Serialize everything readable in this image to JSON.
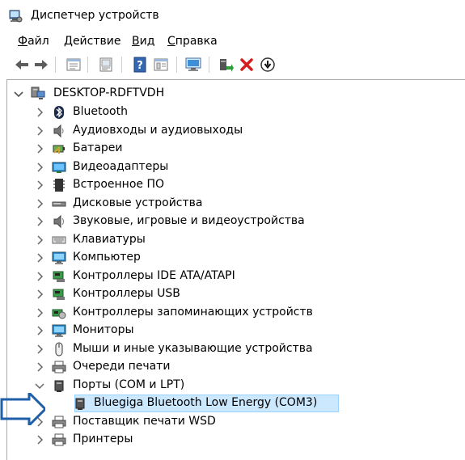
{
  "window": {
    "title": "Диспетчер устройств",
    "icon": "device-manager-icon"
  },
  "menu": {
    "file": {
      "first": "Ф",
      "rest": "айл"
    },
    "action": {
      "first": "Д",
      "rest": "ействие"
    },
    "view": {
      "first": "В",
      "rest": "ид"
    },
    "help": {
      "first": "С",
      "rest": "правка"
    }
  },
  "toolbar": {
    "icons": [
      "back-icon",
      "forward-icon",
      "properties-icon",
      "update-driver-icon",
      "help-icon",
      "show-hidden-icon",
      "monitor-scan-icon",
      "add-driver-icon",
      "uninstall-icon",
      "disable-icon"
    ]
  },
  "tree": {
    "root": "DESKTOP-RDFTVDH",
    "items": [
      {
        "label": "Bluetooth",
        "icon": "bluetooth-icon"
      },
      {
        "label": "Аудиовходы и аудиовыходы",
        "icon": "speaker-icon"
      },
      {
        "label": "Батареи",
        "icon": "battery-icon"
      },
      {
        "label": "Видеоадаптеры",
        "icon": "display-adapter-icon"
      },
      {
        "label": "Встроенное ПО",
        "icon": "firmware-icon"
      },
      {
        "label": "Дисковые устройства",
        "icon": "disk-drive-icon"
      },
      {
        "label": "Звуковые, игровые и видеоустройства",
        "icon": "sound-icon"
      },
      {
        "label": "Клавиатуры",
        "icon": "keyboard-icon"
      },
      {
        "label": "Компьютер",
        "icon": "computer-icon"
      },
      {
        "label": "Контроллеры IDE ATA/ATAPI",
        "icon": "ide-controller-icon"
      },
      {
        "label": "Контроллеры USB",
        "icon": "usb-controller-icon"
      },
      {
        "label": "Контроллеры запоминающих устройств",
        "icon": "storage-controller-icon"
      },
      {
        "label": "Мониторы",
        "icon": "monitor-icon"
      },
      {
        "label": "Мыши и иные указывающие устройства",
        "icon": "mouse-icon"
      },
      {
        "label": "Очереди печати",
        "icon": "print-queue-icon"
      },
      {
        "label": "Порты (COM и LPT)",
        "icon": "port-icon",
        "expanded": true
      },
      {
        "label": "Bluegiga Bluetooth Low Energy (COM3)",
        "icon": "port-device-icon",
        "child": true,
        "selected": true
      },
      {
        "label": "Поставщик печати WSD",
        "icon": "wsd-printer-icon"
      },
      {
        "label": "Принтеры",
        "icon": "printer-icon"
      }
    ]
  },
  "colors": {
    "selection_bg": "#cce8ff",
    "selection_border": "#99d1ff",
    "pointer_arrow": "#1f5fa8"
  }
}
